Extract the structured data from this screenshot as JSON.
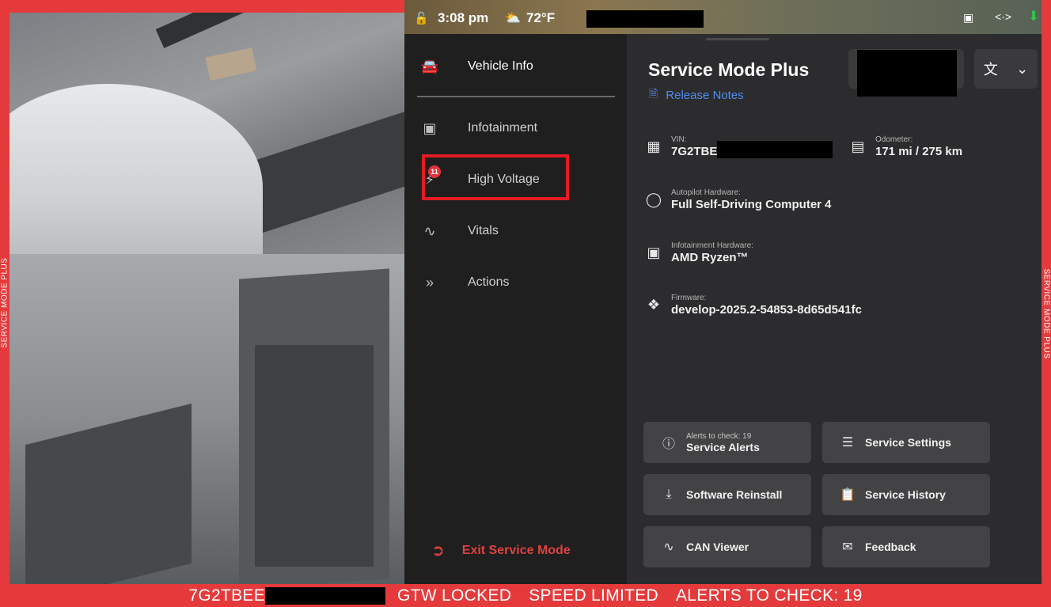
{
  "frame": {
    "top_label": "SERVICE MODE PLUS",
    "side_label": "SERVICE MODE PLUS"
  },
  "statusbar": {
    "time": "3:08 pm",
    "temperature": "72°F"
  },
  "nav": {
    "items": [
      {
        "label": "Vehicle Info",
        "icon": "car-icon"
      },
      {
        "label": "Infotainment",
        "icon": "chip-icon"
      },
      {
        "label": "High Voltage",
        "icon": "lightning-icon",
        "badge": "11"
      },
      {
        "label": "Vitals",
        "icon": "pulse-icon"
      },
      {
        "label": "Actions",
        "icon": "double-chevron-icon"
      }
    ],
    "exit_label": "Exit Service Mode"
  },
  "main": {
    "title": "Service Mode Plus",
    "release_notes": "Release Notes",
    "vin": {
      "label": "VIN:",
      "value": "7G2TBE"
    },
    "odometer": {
      "label": "Odometer:",
      "value": "171 mi / 275 km"
    },
    "autopilot": {
      "label": "Autopilot Hardware:",
      "value": "Full Self-Driving Computer 4"
    },
    "infotainment": {
      "label": "Infotainment Hardware:",
      "value": "AMD Ryzen™"
    },
    "firmware": {
      "label": "Firmware:",
      "value": "develop-2025.2-54853-8d65d541fc"
    },
    "actions": {
      "service_alerts_sub": "Alerts to check: 19",
      "service_alerts": "Service Alerts",
      "service_settings": "Service Settings",
      "software_reinstall": "Software Reinstall",
      "service_history": "Service History",
      "can_viewer": "CAN Viewer",
      "feedback": "Feedback"
    }
  },
  "bottombar": {
    "vin_prefix": "7G2TBEE",
    "gtw": "GTW LOCKED",
    "speed": "SPEED LIMITED",
    "alerts": "ALERTS TO CHECK: 19"
  },
  "colors": {
    "frame_red": "#e53a3b",
    "nav_bg": "#1f1f20",
    "main_bg": "#2c2c2e",
    "link_blue": "#4e8df0",
    "exit_red": "#e0413f",
    "button_bg": "#434345"
  }
}
